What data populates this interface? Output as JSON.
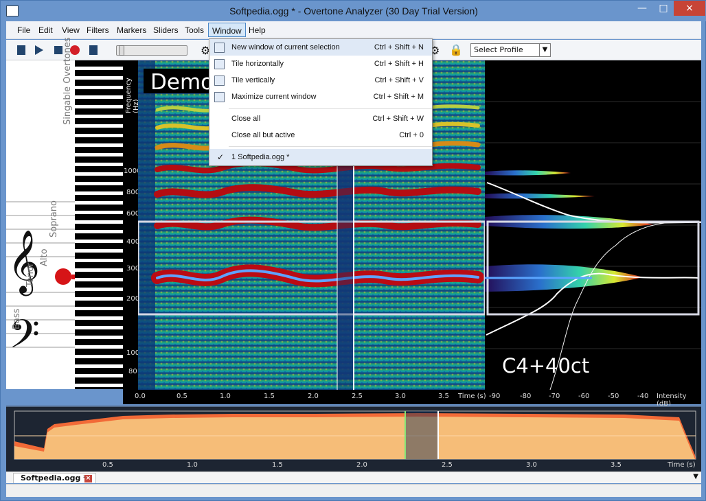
{
  "window": {
    "title": "Softpedia.ogg * - Overtone Analyzer (30 Day Trial Version)"
  },
  "menu": {
    "items": [
      "File",
      "Edit",
      "View",
      "Filters",
      "Markers",
      "Sliders",
      "Tools",
      "Window",
      "Help"
    ]
  },
  "toolbar": {
    "profile": "Select Profile"
  },
  "window_menu": [
    {
      "label": "New window of current selection",
      "shortcut": "Ctrl + Shift + N",
      "icon": "new-window-icon"
    },
    {
      "label": "Tile horizontally",
      "shortcut": "Ctrl + Shift + H",
      "icon": "tile-horizontal-icon"
    },
    {
      "label": "Tile vertically",
      "shortcut": "Ctrl + Shift + V",
      "icon": "tile-vertical-icon"
    },
    {
      "label": "Maximize current window",
      "shortcut": "Ctrl + Shift + M",
      "icon": "maximize-icon"
    },
    {
      "label": "Close all",
      "shortcut": "Ctrl + Shift + W"
    },
    {
      "label": "Close all but active",
      "shortcut": "Ctrl + 0"
    },
    {
      "label": "1 Softpedia.ogg *",
      "shortcut": "",
      "checked": true
    }
  ],
  "spectrogram": {
    "demo_text": "Demo",
    "freq_label": "Frequency (Hz)",
    "freq_ticks": [
      "1000",
      "800",
      "600",
      "400",
      "300",
      "200",
      "100",
      "80"
    ],
    "time_ticks": [
      "0.0",
      "0.5",
      "1.0",
      "1.5",
      "2.0",
      "2.5",
      "3.0",
      "3.5"
    ],
    "time_label": "Time (s)"
  },
  "intensity": {
    "note_label": "C4+40ct",
    "ticks": [
      "-90",
      "-80",
      "-70",
      "-60",
      "-50",
      "-40"
    ],
    "label": "Intensity (dB)"
  },
  "piano": {
    "vertical_labels": [
      "Singable Overtones",
      "Soprano",
      "Alto",
      "Tenor",
      "Bass"
    ]
  },
  "overview": {
    "time_ticks": [
      "0.5",
      "1.0",
      "1.5",
      "2.0",
      "2.5",
      "3.0",
      "3.5"
    ],
    "time_label": "Time (s)"
  },
  "tab": {
    "name": "Softpedia.ogg *"
  },
  "colors": {
    "accent": "#6a95cc",
    "spectrogram_hot": "#b3001b",
    "spectrogram_cold": "#1d60c3"
  }
}
